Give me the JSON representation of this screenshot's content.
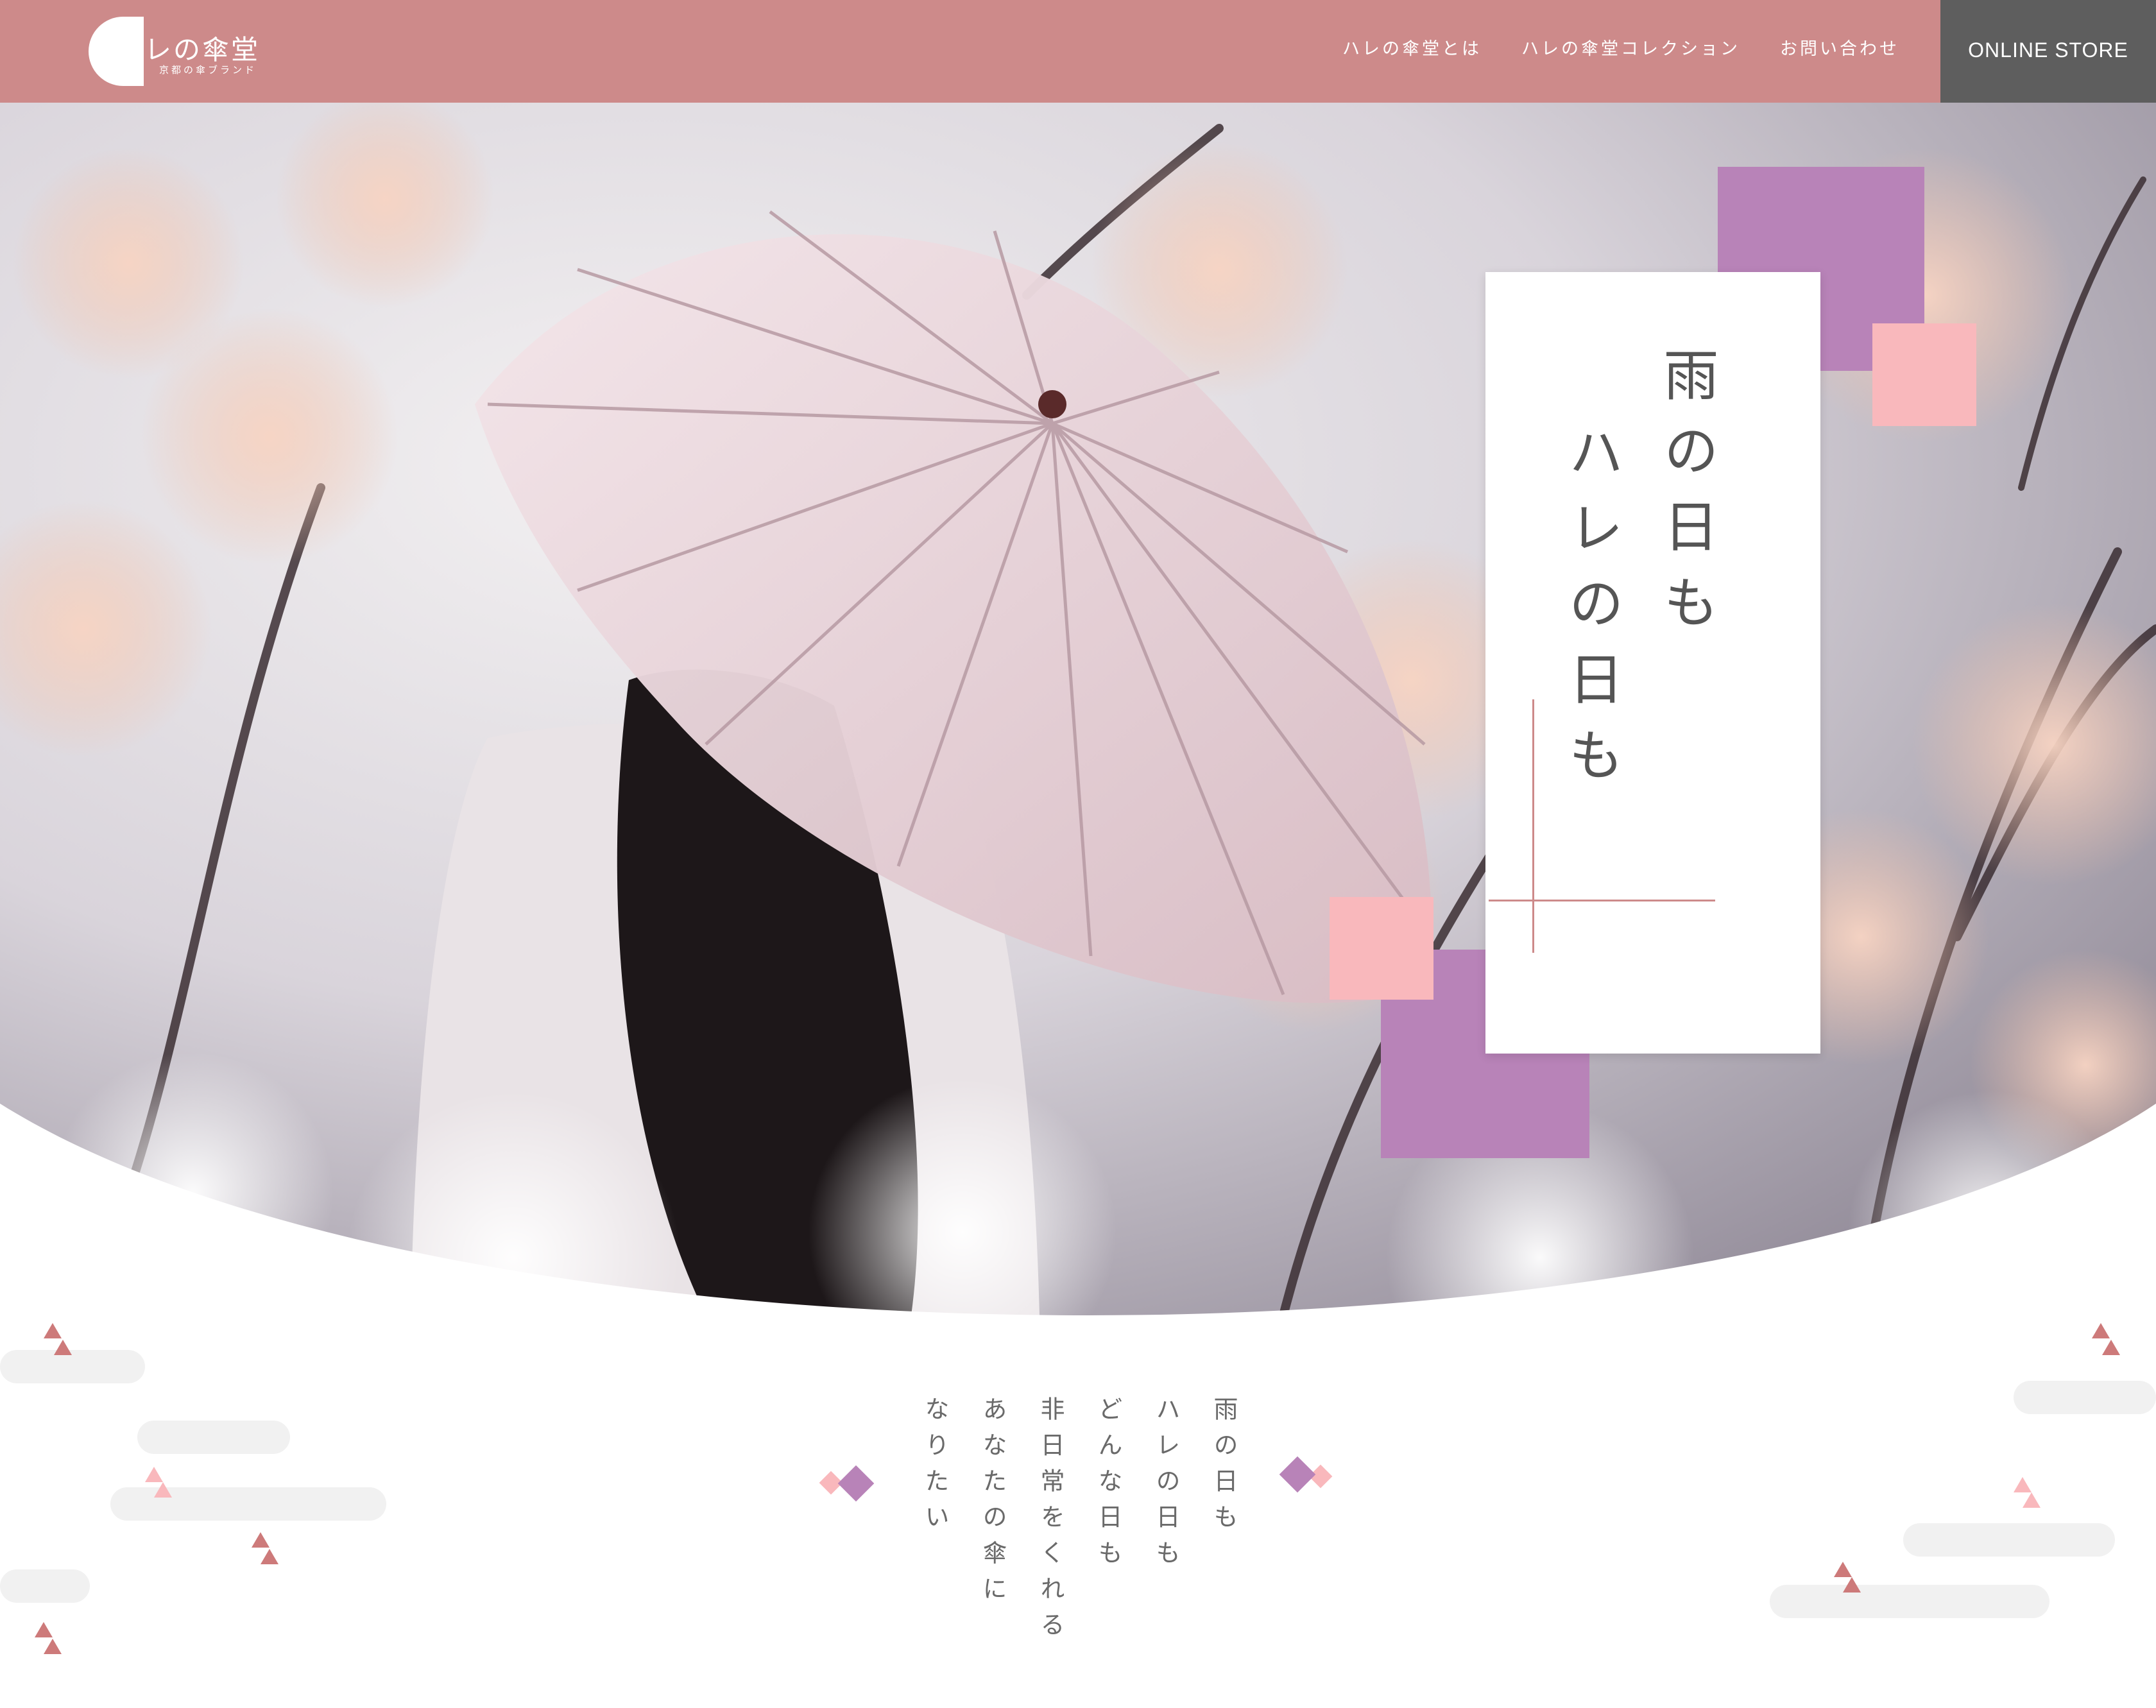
{
  "header": {
    "logo_text": "ハレの傘堂",
    "logo_subtitle": "京都の傘ブランド",
    "nav": [
      {
        "label": "ハレの傘堂とは"
      },
      {
        "label": "ハレの傘堂コレクション"
      },
      {
        "label": "お問い合わせ"
      }
    ],
    "store_label": "ONLINE STORE"
  },
  "hero": {
    "title_line1": "雨の日も",
    "title_line2": "ハレの日も"
  },
  "message": {
    "lines": [
      "雨の日も",
      "ハレの日も",
      "どんな日も",
      "非日常をくれる",
      "あなたの傘に",
      "なりたい"
    ]
  },
  "colors": {
    "header_bg": "#cd8a8a",
    "store_bg": "#5e5e5e",
    "accent_purple": "#b883b8",
    "accent_pink": "#f9b8bc",
    "accent_rose": "#cd7a7a"
  }
}
